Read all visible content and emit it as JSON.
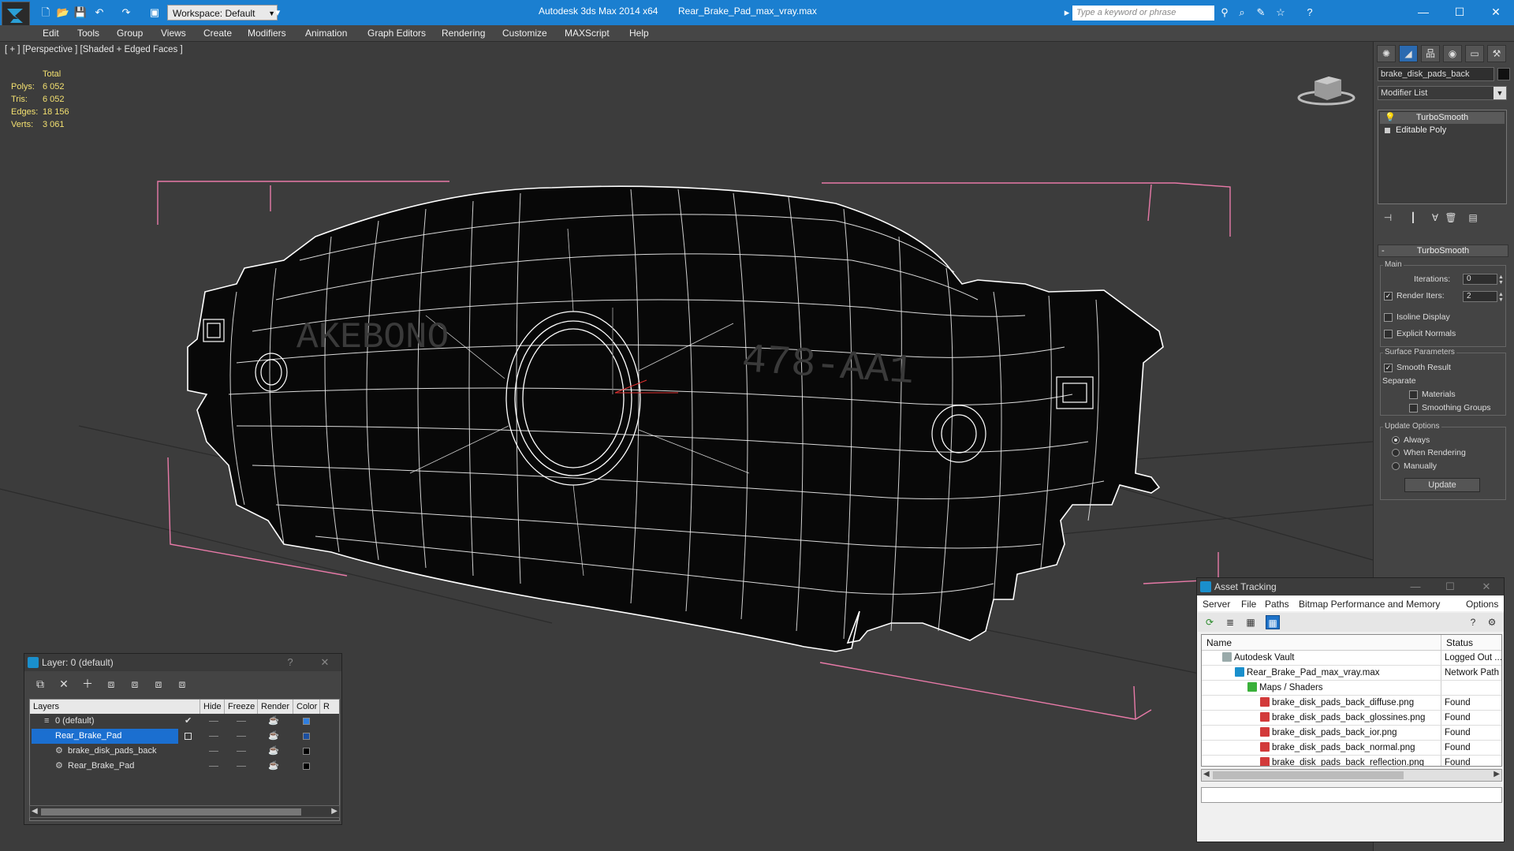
{
  "title_bar": {
    "workspace": "Workspace: Default",
    "app_title": "Autodesk 3ds Max  2014 x64",
    "file_name": "Rear_Brake_Pad_max_vray.max",
    "search_placeholder": "Type a keyword or phrase"
  },
  "menu": [
    "Edit",
    "Tools",
    "Group",
    "Views",
    "Create",
    "Modifiers",
    "Animation",
    "Graph Editors",
    "Rendering",
    "Customize",
    "MAXScript",
    "Help"
  ],
  "viewport": {
    "label": "[ + ] [Perspective ] [Shaded + Edged Faces ]",
    "stats": {
      "header": "Total",
      "polys_label": "Polys:",
      "polys": "6 052",
      "tris_label": "Tris:",
      "tris": "6 052",
      "edges_label": "Edges:",
      "edges": "18 156",
      "verts_label": "Verts:",
      "verts": "3 061"
    },
    "embossed_text_left": "AKEBONO",
    "embossed_text_right": "478-AA1"
  },
  "command_panel": {
    "object_name": "brake_disk_pads_back",
    "modifier_list": "Modifier List",
    "stack": [
      "TurboSmooth",
      "Editable Poly"
    ],
    "rollout_title": "TurboSmooth",
    "main_group": "Main",
    "iterations_label": "Iterations:",
    "iterations_value": "0",
    "render_iters_label": "Render Iters:",
    "render_iters_value": "2",
    "isoline_display": "Isoline Display",
    "explicit_normals": "Explicit Normals",
    "surface_params_group": "Surface Parameters",
    "smooth_result": "Smooth Result",
    "separate_label": "Separate",
    "materials": "Materials",
    "smoothing_groups": "Smoothing Groups",
    "update_options_group": "Update Options",
    "always": "Always",
    "when_rendering": "When Rendering",
    "manually": "Manually",
    "update_button": "Update"
  },
  "layer_window": {
    "title": "Layer: 0 (default)",
    "help": "?",
    "close": "✕",
    "columns": [
      "Layers",
      "Hide",
      "Freeze",
      "Render",
      "Color",
      "R"
    ],
    "rows": [
      {
        "name": "0 (default)",
        "color": "#2f7fe0"
      },
      {
        "name": "Rear_Brake_Pad",
        "color": "#1b4fa0"
      },
      {
        "name": "brake_disk_pads_back",
        "color": "#000000"
      },
      {
        "name": "Rear_Brake_Pad",
        "color": "#000000"
      }
    ]
  },
  "asset_tracking": {
    "title": "Asset Tracking",
    "menu": [
      "Server",
      "File",
      "Paths",
      "Bitmap Performance and Memory",
      "Options"
    ],
    "col_name": "Name",
    "col_status": "Status",
    "rows": [
      {
        "name": "Autodesk Vault",
        "status": "Logged Out ..."
      },
      {
        "name": "Rear_Brake_Pad_max_vray.max",
        "status": "Network Path"
      },
      {
        "name": "Maps / Shaders",
        "status": ""
      },
      {
        "name": "brake_disk_pads_back_diffuse.png",
        "status": "Found"
      },
      {
        "name": "brake_disk_pads_back_glossines.png",
        "status": "Found"
      },
      {
        "name": "brake_disk_pads_back_ior.png",
        "status": "Found"
      },
      {
        "name": "brake_disk_pads_back_normal.png",
        "status": "Found"
      },
      {
        "name": "brake_disk_pads_back_reflection.png",
        "status": "Found"
      }
    ]
  },
  "colors": {
    "titlebar": "#1b7fd0",
    "viewport_bg": "#3c3c3c",
    "wire": "#ffffff",
    "bbox_corners": "#e87aa8",
    "stats_text": "#f3e070",
    "selection": "#1b6fd0"
  }
}
